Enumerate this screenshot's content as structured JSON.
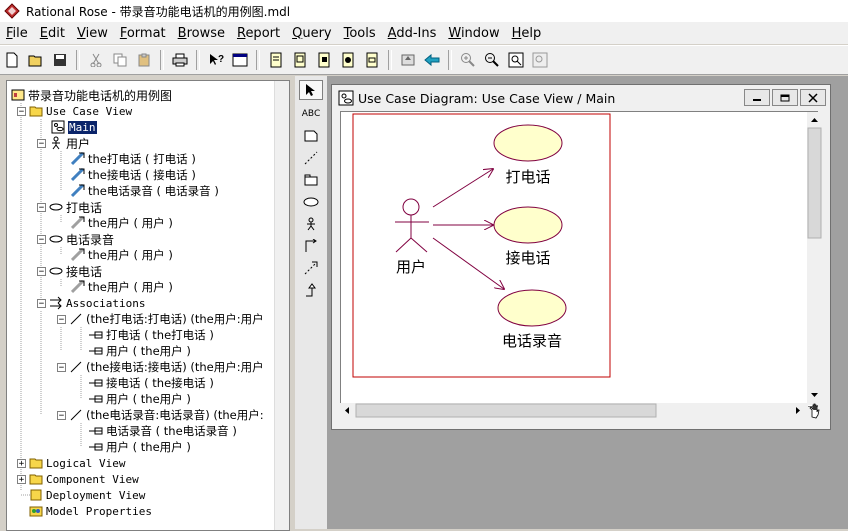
{
  "window": {
    "app_title": "Rational Rose - 带录音功能电话机的用例图.mdl"
  },
  "menu": [
    {
      "label": "File",
      "key": "F",
      "rest": "ile"
    },
    {
      "label": "Edit",
      "key": "E",
      "rest": "dit"
    },
    {
      "label": "View",
      "key": "V",
      "rest": "iew"
    },
    {
      "label": "Format",
      "key": "F",
      "rest": "ormat",
      "prefix": ""
    },
    {
      "label": "Browse",
      "key": "B",
      "rest": "rowse"
    },
    {
      "label": "Report",
      "key": "R",
      "rest": "eport"
    },
    {
      "label": "Query",
      "key": "Q",
      "rest": "uery"
    },
    {
      "label": "Tools",
      "key": "T",
      "rest": "ools"
    },
    {
      "label": "Add-Ins",
      "key": "A",
      "rest": "dd-Ins"
    },
    {
      "label": "Window",
      "key": "W",
      "rest": "indow"
    },
    {
      "label": "Help",
      "key": "H",
      "rest": "elp"
    }
  ],
  "browser": {
    "root": "带录音功能电话机的用例图",
    "use_case_view": "Use Case View",
    "main_diagram": "Main",
    "actor_user": "用户",
    "rel_1": "the打电话 ( 打电话 )",
    "rel_2": "the接电话 ( 接电话 )",
    "rel_3": "the电话录音 ( 电话录音 )",
    "uc_call": "打电话",
    "uc_call_rel": "the用户 ( 用户 )",
    "uc_record": "电话录音",
    "uc_record_rel": "the用户 ( 用户 )",
    "uc_answer": "接电话",
    "uc_answer_rel": "the用户 ( 用户 )",
    "associations": "Associations",
    "assoc_1": "(the打电话:打电话) (the用户:用户",
    "assoc_1_a": "打电话 ( the打电话 )",
    "assoc_1_b": "用户 ( the用户 )",
    "assoc_2": "(the接电话:接电话) (the用户:用户",
    "assoc_2_a": "接电话 ( the接电话 )",
    "assoc_2_b": "用户 ( the用户 )",
    "assoc_3": "(the电话录音:电话录音) (the用户:",
    "assoc_3_a": "电话录音 ( the电话录音 )",
    "assoc_3_b": "用户 ( the用户 )",
    "logical_view": "Logical View",
    "component_view": "Component View",
    "deployment_view": "Deployment View",
    "model_properties": "Model Properties"
  },
  "tools": {
    "text_tool": "ABC"
  },
  "diagram": {
    "title": "Use Case Diagram: Use Case View / Main",
    "actor": "用户",
    "use_cases": [
      "打电话",
      "接电话",
      "电话录音"
    ],
    "colors": {
      "usecase_fill": "#ffffcc",
      "line": "#800040",
      "boundary": "#c00000"
    }
  }
}
